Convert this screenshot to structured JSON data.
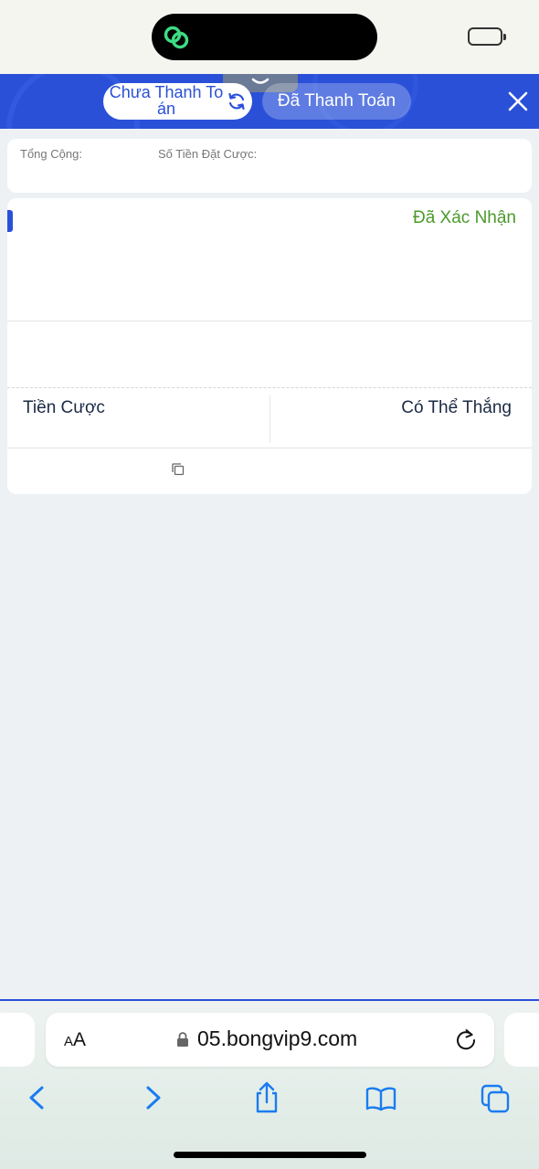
{
  "header": {
    "tab_unpaid": "Chưa Thanh Toán",
    "tab_paid": "Đã Thanh Toán"
  },
  "summary": {
    "total_label": "Tổng Cộng:",
    "stake_amount_label": "Số Tiền Đặt Cược:"
  },
  "bet_card": {
    "status": "Đã Xác Nhận",
    "stake_label": "Tiền Cược",
    "potential_win_label": "Có Thể Thắng"
  },
  "browser": {
    "text_size_small": "A",
    "text_size_large": "A",
    "url": "05.bongvip9.com"
  },
  "colors": {
    "header_blue": "#2a50d8",
    "confirmed_green": "#4a9a2a",
    "ios_blue": "#1a7cf0"
  },
  "icons": [
    "link-icon",
    "battery-icon",
    "chevron-down-icon",
    "refresh-icon",
    "close-icon",
    "copy-icon",
    "lock-icon",
    "reload-icon",
    "back-icon",
    "forward-icon",
    "share-icon",
    "bookmarks-icon",
    "tabs-icon"
  ]
}
